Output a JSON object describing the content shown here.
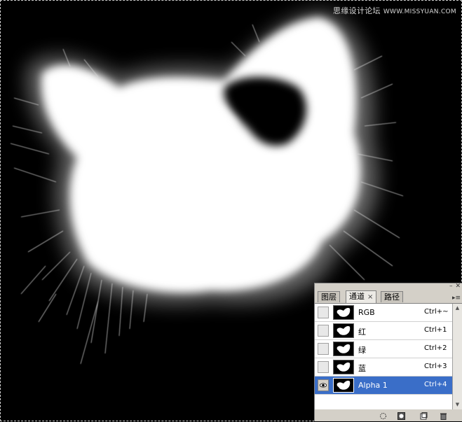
{
  "watermark": {
    "text": "思缘设计论坛",
    "url": "WWW.MISSYUAN.COM"
  },
  "panel": {
    "tabs": [
      {
        "label": "图层",
        "active": false
      },
      {
        "label": "通道",
        "active": true,
        "close": "×"
      },
      {
        "label": "路径",
        "active": false
      }
    ],
    "channels": [
      {
        "name": "RGB",
        "shortcut": "Ctrl+~",
        "visible": false,
        "selected": false
      },
      {
        "name": "红",
        "shortcut": "Ctrl+1",
        "visible": false,
        "selected": false
      },
      {
        "name": "绿",
        "shortcut": "Ctrl+2",
        "visible": false,
        "selected": false
      },
      {
        "name": "蓝",
        "shortcut": "Ctrl+3",
        "visible": false,
        "selected": false
      },
      {
        "name": "Alpha 1",
        "shortcut": "Ctrl+4",
        "visible": true,
        "selected": true
      }
    ],
    "bottom_icons": [
      "load-selection-icon",
      "save-selection-icon",
      "new-channel-icon",
      "delete-channel-icon"
    ]
  },
  "colors": {
    "selected_row": "#3a6ec8",
    "panel_bg": "#d4d0c8"
  }
}
